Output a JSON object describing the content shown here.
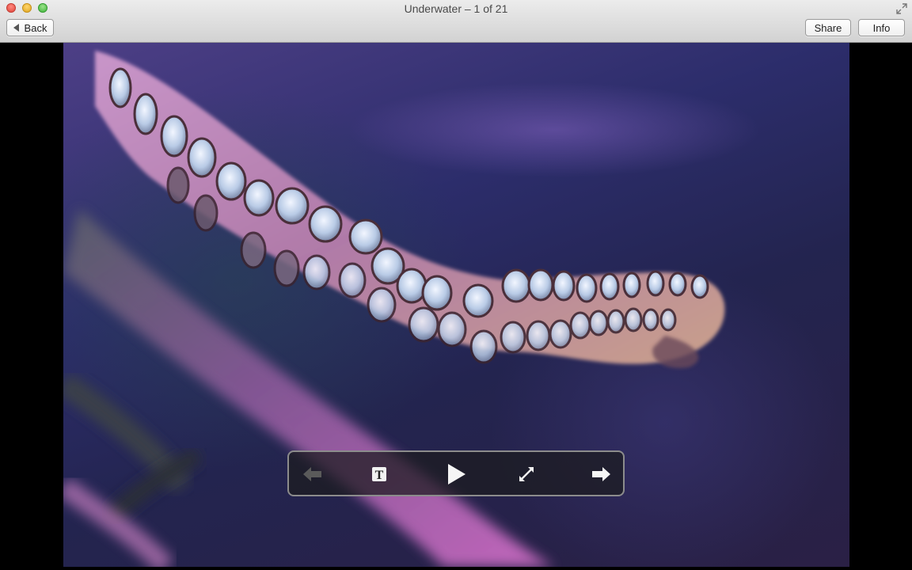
{
  "window": {
    "title": "Underwater – 1 of 21"
  },
  "toolbar": {
    "back_label": "Back",
    "share_label": "Share",
    "info_label": "Info"
  },
  "photo": {
    "album": "Underwater",
    "index": 1,
    "total": 21
  },
  "hud": {
    "prev_icon": "arrow-left-icon",
    "prev_enabled": false,
    "text_icon": "text-icon",
    "text_glyph": "T",
    "play_icon": "play-icon",
    "fullscreen_icon": "fullscreen-icon",
    "next_icon": "arrow-right-icon"
  },
  "colors": {
    "titlebar": "#dcdcdc",
    "hud_background": "#1c1c1e",
    "hud_border": "#8c8c8c",
    "tentacle": "#b77fb0",
    "sucker": "#c9d6ec"
  }
}
